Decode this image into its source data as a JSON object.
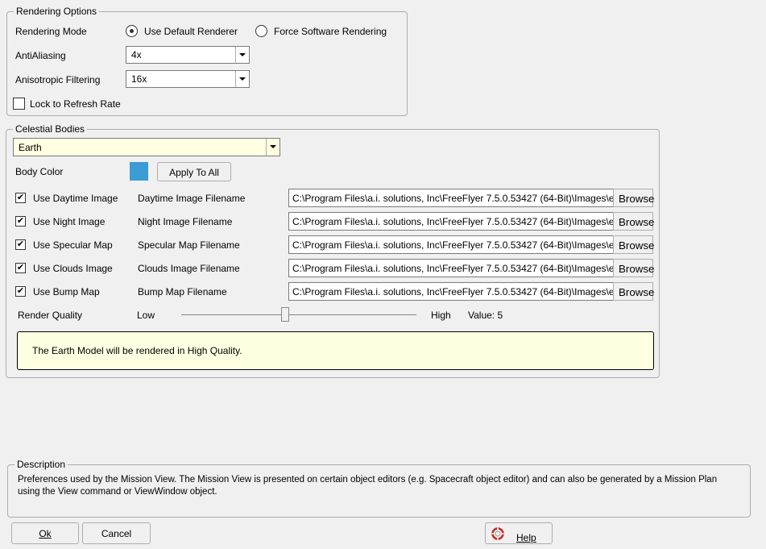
{
  "rendering_options": {
    "title": "Rendering Options",
    "rendering_mode_label": "Rendering Mode",
    "rendering_modes": [
      {
        "label": "Use Default Renderer",
        "selected": true
      },
      {
        "label": "Force Software Rendering",
        "selected": false
      }
    ],
    "antialiasing_label": "AntiAliasing",
    "antialiasing_value": "4x",
    "anisotropic_label": "Anisotropic Filtering",
    "anisotropic_value": "16x",
    "lock_refresh_label": "Lock to Refresh Rate",
    "lock_refresh_checked": false
  },
  "celestial_bodies": {
    "title": "Celestial Bodies",
    "selected_body": "Earth",
    "body_color_label": "Body Color",
    "body_color": "#3b9dd3",
    "apply_to_all_label": "Apply To All",
    "images": [
      {
        "check_label": "Use Daytime Image",
        "checked": true,
        "file_label": "Daytime Image Filename",
        "path": "C:\\Program Files\\a.i. solutions, Inc\\FreeFlyer 7.5.0.53427 (64-Bit)\\Images\\ea",
        "browse": "Browse"
      },
      {
        "check_label": "Use Night Image",
        "checked": true,
        "file_label": "Night Image Filename",
        "path": "C:\\Program Files\\a.i. solutions, Inc\\FreeFlyer 7.5.0.53427 (64-Bit)\\Images\\ea",
        "browse": "Browse"
      },
      {
        "check_label": "Use Specular Map",
        "checked": true,
        "file_label": "Specular Map Filename",
        "path": "C:\\Program Files\\a.i. solutions, Inc\\FreeFlyer 7.5.0.53427 (64-Bit)\\Images\\ea",
        "browse": "Browse"
      },
      {
        "check_label": "Use Clouds Image",
        "checked": true,
        "file_label": "Clouds Image Filename",
        "path": "C:\\Program Files\\a.i. solutions, Inc\\FreeFlyer 7.5.0.53427 (64-Bit)\\Images\\ea",
        "browse": "Browse"
      },
      {
        "check_label": "Use Bump Map",
        "checked": true,
        "file_label": "Bump Map Filename",
        "path": "C:\\Program Files\\a.i. solutions, Inc\\FreeFlyer 7.5.0.53427 (64-Bit)\\Images\\ea",
        "browse": "Browse"
      }
    ],
    "render_quality_label": "Render Quality",
    "slider_low": "Low",
    "slider_high": "High",
    "slider_value_text": "Value: 5",
    "slider_fraction": 0.44,
    "quality_note": "The Earth Model will be rendered in High Quality."
  },
  "description": {
    "title": "Description",
    "text_line1": "Preferences used by the Mission View.  The Mission View is presented on certain object editors (e.g. Spacecraft object editor) and can also be generated by a Mission Plan",
    "text_line2": "using the View command or ViewWindow object."
  },
  "buttons": {
    "ok": "Ok",
    "cancel": "Cancel",
    "help": "Help"
  },
  "icons": {
    "help": "lifebuoy-icon",
    "checkmark": "✔"
  }
}
